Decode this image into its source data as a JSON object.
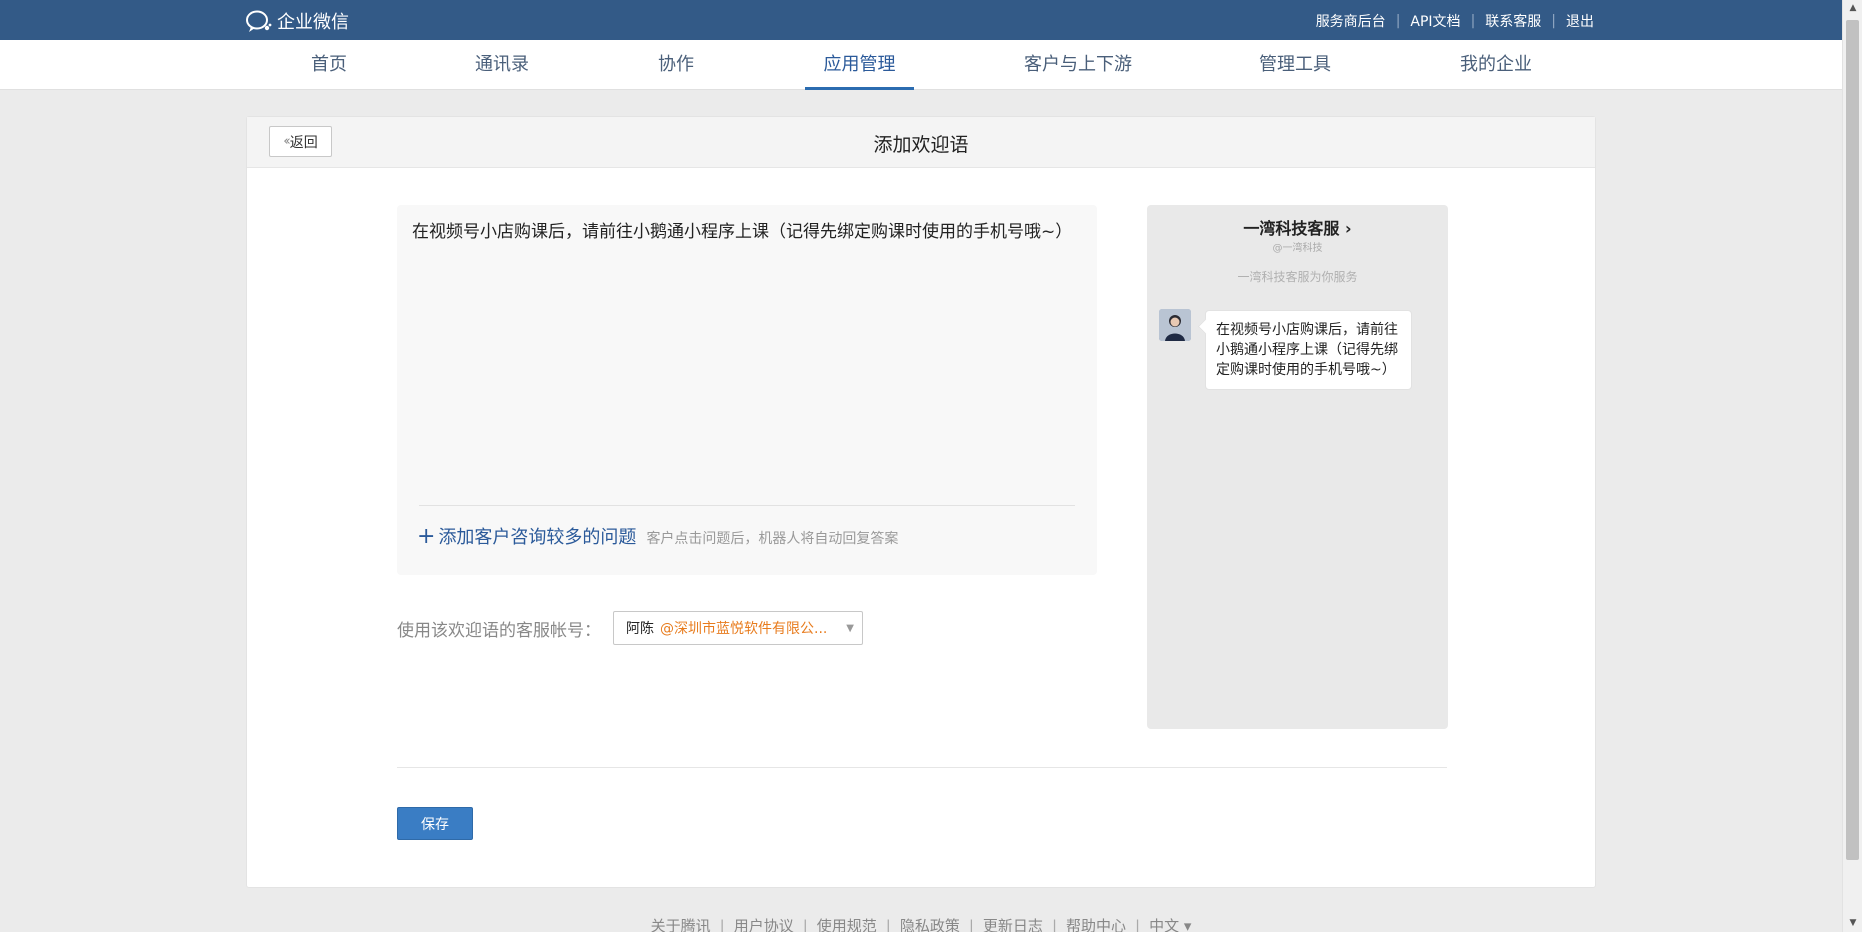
{
  "topbar": {
    "logo_text": "企业微信",
    "links": [
      "服务商后台",
      "API文档",
      "联系客服",
      "退出"
    ]
  },
  "nav": {
    "items": [
      "首页",
      "通讯录",
      "协作",
      "应用管理",
      "客户与上下游",
      "管理工具",
      "我的企业"
    ],
    "active": "应用管理"
  },
  "page": {
    "back_label": "返回",
    "title": "添加欢迎语"
  },
  "editor": {
    "content": "在视频号小店购课后，请前往小鹅通小程序上课（记得先绑定购课时使用的手机号哦~）",
    "add_faq_label": "添加客户咨询较多的问题",
    "add_faq_hint": "客户点击问题后，机器人将自动回复答案"
  },
  "account": {
    "label": "使用该欢迎语的客服帐号：",
    "selected_name": "阿陈",
    "selected_org": "@深圳市蓝悦软件有限公..."
  },
  "preview": {
    "service_name": "一湾科技客服 ›",
    "corp": "@一湾科技",
    "desc": "一湾科技客服为你服务",
    "message": "在视频号小店购课后，请前往小鹅通小程序上课（记得先绑定购课时使用的手机号哦~）"
  },
  "actions": {
    "save_label": "保存"
  },
  "footer": {
    "links": [
      "关于腾讯",
      "用户协议",
      "使用规范",
      "隐私政策",
      "更新日志",
      "帮助中心",
      "中文 ▾"
    ]
  },
  "colors": {
    "topbar": "#335a87",
    "accent": "#2b6cb0",
    "save_button": "#3a7dc4",
    "org_orange": "#e87c1e"
  }
}
